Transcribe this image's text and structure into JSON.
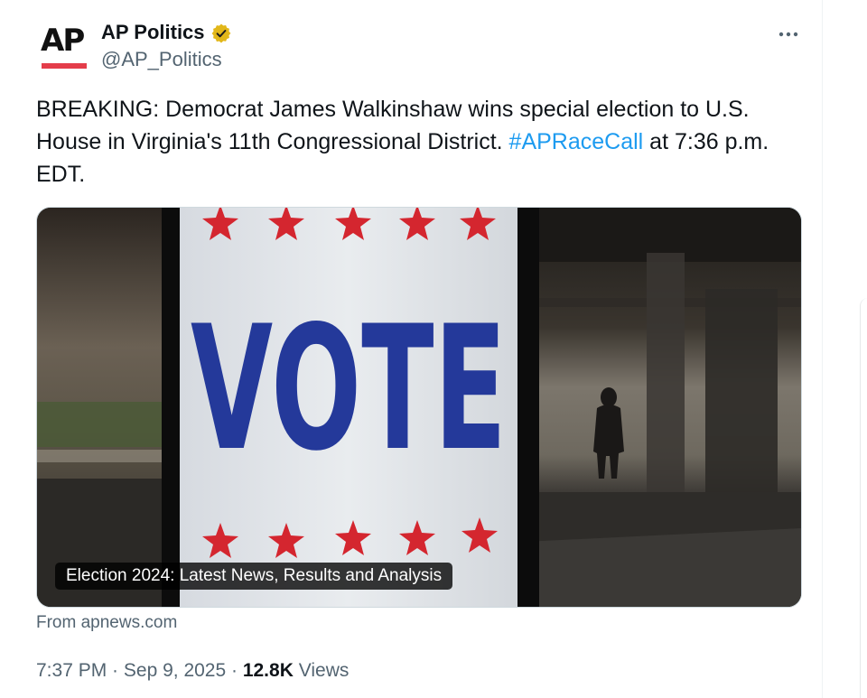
{
  "author": {
    "avatar_text": "AP",
    "display_name": "AP Politics",
    "handle": "@AP_Politics",
    "verified_badge_color": "#e2b719",
    "avatar_bar_color": "#e43d4a"
  },
  "tweet": {
    "text_before": "BREAKING: Democrat James Walkinshaw wins special election to U.S. House in Virginia's 11th Congressional District. ",
    "hashtag": "#APRaceCall",
    "text_after": " at 7:36 p.m. EDT.",
    "hashtag_color": "#1d9bf0"
  },
  "media": {
    "sign_text": "VOTE",
    "caption": "Election 2024: Latest News, Results and Analysis",
    "source": "From apnews.com",
    "sign_text_color": "#24399a",
    "star_color": "#d4262f"
  },
  "meta": {
    "time": "7:37 PM",
    "separator": " · ",
    "date": "Sep 9, 2025",
    "views_count": "12.8K",
    "views_label": "Views"
  },
  "icons": {
    "more": "more-options-icon",
    "verified": "verified-badge-icon"
  }
}
